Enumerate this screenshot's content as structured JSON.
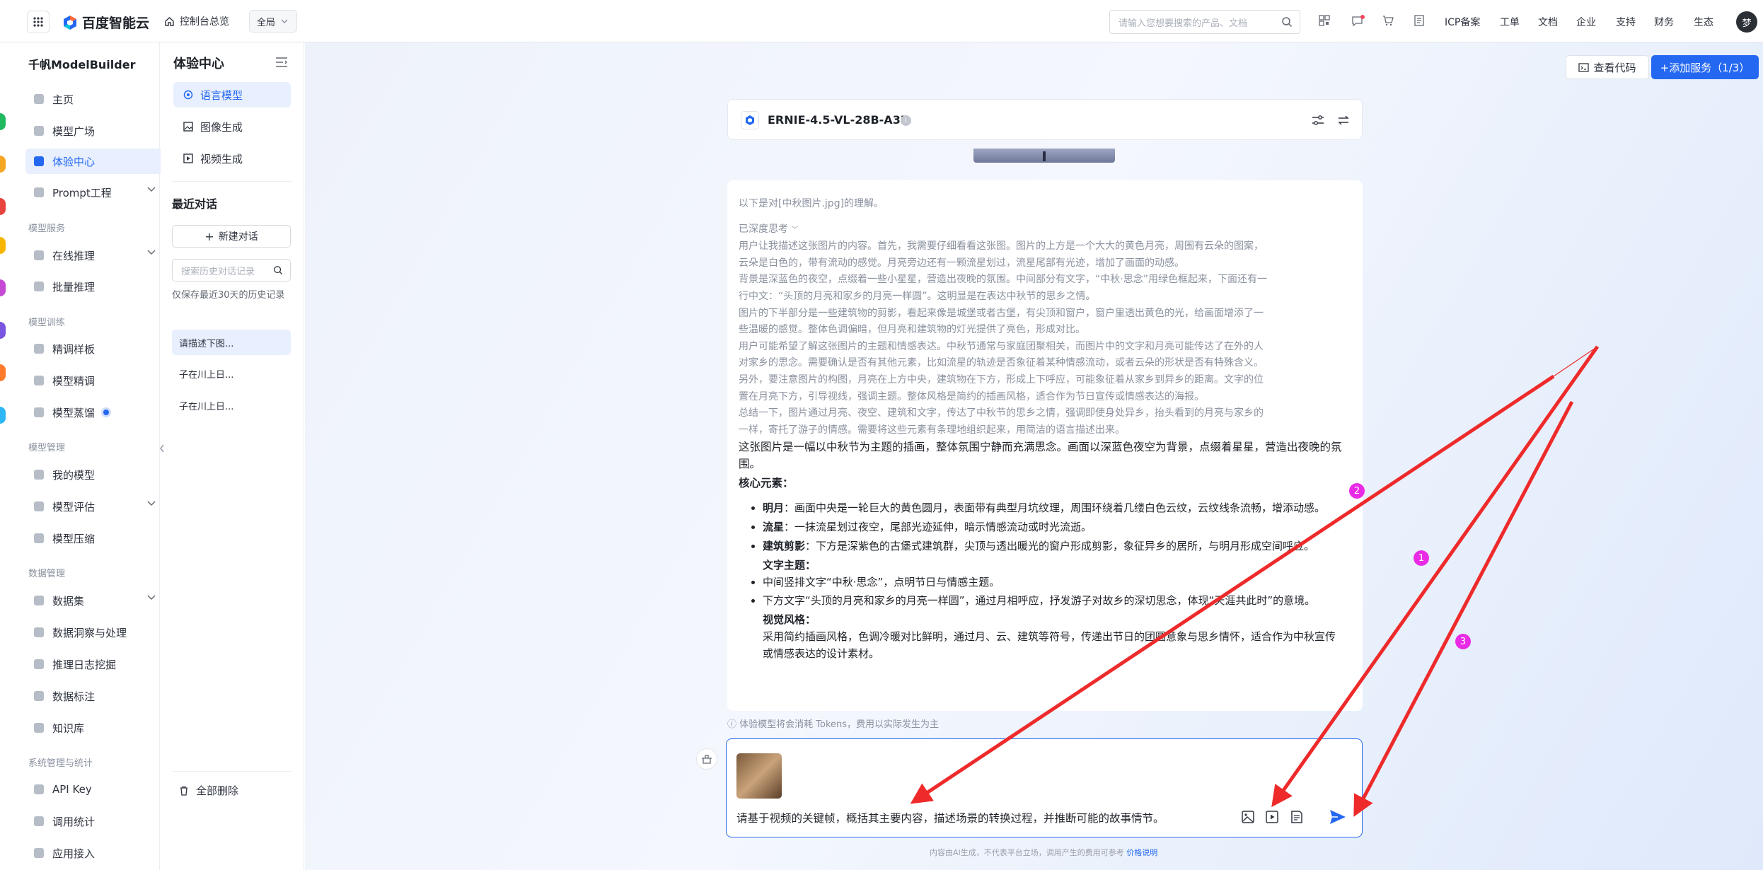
{
  "topnav": {
    "brand": "百度智能云",
    "console": "控制台总览",
    "region": "全局",
    "search_placeholder": "请输入您想要搜索的产品、文档",
    "links": [
      "ICP备案",
      "工单",
      "文档",
      "企业",
      "支持",
      "财务",
      "生态"
    ],
    "avatar": "梦"
  },
  "sidebar": {
    "title": "千帆ModelBuilder",
    "items": [
      {
        "label": "主页"
      },
      {
        "label": "模型广场"
      },
      {
        "label": "体验中心"
      },
      {
        "label": "Prompt工程"
      },
      {
        "label": "在线推理"
      },
      {
        "label": "批量推理"
      },
      {
        "label": "精调样板"
      },
      {
        "label": "模型精调"
      },
      {
        "label": "模型蒸馏"
      },
      {
        "label": "我的模型"
      },
      {
        "label": "模型评估"
      },
      {
        "label": "模型压缩"
      },
      {
        "label": "数据集"
      },
      {
        "label": "数据洞察与处理"
      },
      {
        "label": "推理日志挖掘"
      },
      {
        "label": "数据标注"
      },
      {
        "label": "知识库"
      },
      {
        "label": "API Key"
      },
      {
        "label": "调用统计"
      },
      {
        "label": "应用接入"
      }
    ],
    "groups": [
      "模型服务",
      "模型训练",
      "模型管理",
      "数据管理",
      "系统管理与统计"
    ]
  },
  "exp": {
    "title": "体验中心",
    "items": [
      "语言模型",
      "图像生成",
      "视频生成"
    ],
    "recent_title": "最近对话",
    "new_chat": "新建对话",
    "search_placeholder": "搜索历史对话记录",
    "note": "仅保存最近30天的历史记录",
    "history": [
      "请描述下图...",
      "子在川上日...",
      "子在川上日..."
    ],
    "delete_all": "全部删除"
  },
  "toolbar": {
    "view_code": "查看代码",
    "add_service": "+添加服务（1/3）"
  },
  "model": {
    "name": "ERNIE-4.5-VL-28B-A3B"
  },
  "response": {
    "intro": "以下是对[中秋图片.jpg]的理解。",
    "thinking_label": "已深度思考",
    "thinking": [
      "用户让我描述这张图片的内容。首先，我需要仔细看看这张图。图片的上方是一个大大的黄色月亮，周围有云朵的图案，",
      "云朵是白色的，带有流动的感觉。月亮旁边还有一颗流星划过，流星尾部有光迹，增加了画面的动感。",
      "背景是深蓝色的夜空，点缀着一些小星星，营造出夜晚的氛围。中间部分有文字，“中秋·思念”用绿色框起来，下面还有一",
      "行中文：“头顶的月亮和家乡的月亮一样圆”。这明显是在表达中秋节的思乡之情。",
      "图片的下半部分是一些建筑物的剪影，看起来像是城堡或者古堡，有尖顶和窗户，窗户里透出黄色的光，给画面增添了一",
      "些温暖的感觉。整体色调偏暗，但月亮和建筑物的灯光提供了亮色，形成对比。",
      "用户可能希望了解这张图片的主题和情感表达。中秋节通常与家庭团聚相关，而图片中的文字和月亮可能传达了在外的人",
      "对家乡的思念。需要确认是否有其他元素，比如流星的轨迹是否象征着某种情感流动，或者云朵的形状是否有特殊含义。",
      "另外，要注意图片的构图，月亮在上方中央，建筑物在下方，形成上下呼应，可能象征着从家乡到异乡的距离。文字的位",
      "置在月亮下方，引导视线，强调主题。整体风格是简约的插画风格，适合作为节日宣传或情感表达的海报。",
      "总结一下，图片通过月亮、夜空、建筑和文字，传达了中秋节的思乡之情，强调即使身处异乡，抬头看到的月亮与家乡的",
      "一样，寄托了游子的情感。需要将这些元素有条理地组织起来，用简洁的语言描述出来。"
    ],
    "summary": "这张图片是一幅以中秋节为主题的插画，整体氛围宁静而充满思念。画面以深蓝色夜空为背景，点缀着星星，营造出夜晚的氛围。",
    "core_title": "核心元素：",
    "points": [
      {
        "term": "明月",
        "text": "：画面中央是一轮巨大的黄色圆月，表面带有典型月坑纹理，周围环绕着几缕白色云纹，云纹线条流畅，增添动感。"
      },
      {
        "term": "流星",
        "text": "：一抹流星划过夜空，尾部光迹延伸，暗示情感流动或时光流逝。"
      },
      {
        "term": "建筑剪影",
        "text": "：下方是深紫色的古堡式建筑群，尖顶与透出暖光的窗户形成剪影，象征异乡的居所，与明月形成空间呼应。"
      }
    ],
    "text_theme_title": "文字主题：",
    "text_points": [
      "中间竖排文字“中秋·思念”，点明节日与情感主题。",
      "下方文字“头顶的月亮和家乡的月亮一样圆”，通过月相呼应，抒发游子对故乡的深切思念，体现“天涯共此时”的意境。"
    ],
    "visual_title": "视觉风格：",
    "visual_text": "采用简约插画风格，色调冷暖对比鲜明，通过月、云、建筑等符号，传递出节日的团圆意象与思乡情怀，适合作为中秋宣传或情感表达的设计素材。"
  },
  "token_note": "体验模型将会消耗 Tokens，费用以实际发生为主",
  "input": {
    "text": "请基于视频的关键帧，概括其主要内容，描述场景的转换过程，并推断可能的故事情节。"
  },
  "footer": {
    "note": "内容由AI生成，不代表平台立场，调用产生的费用可参考",
    "link": "价格说明"
  },
  "annotations": [
    "1",
    "2",
    "3"
  ],
  "colors": {
    "accent": "#2468f2",
    "annotation": "#ea2be6",
    "arrow": "#ee2a2a"
  }
}
